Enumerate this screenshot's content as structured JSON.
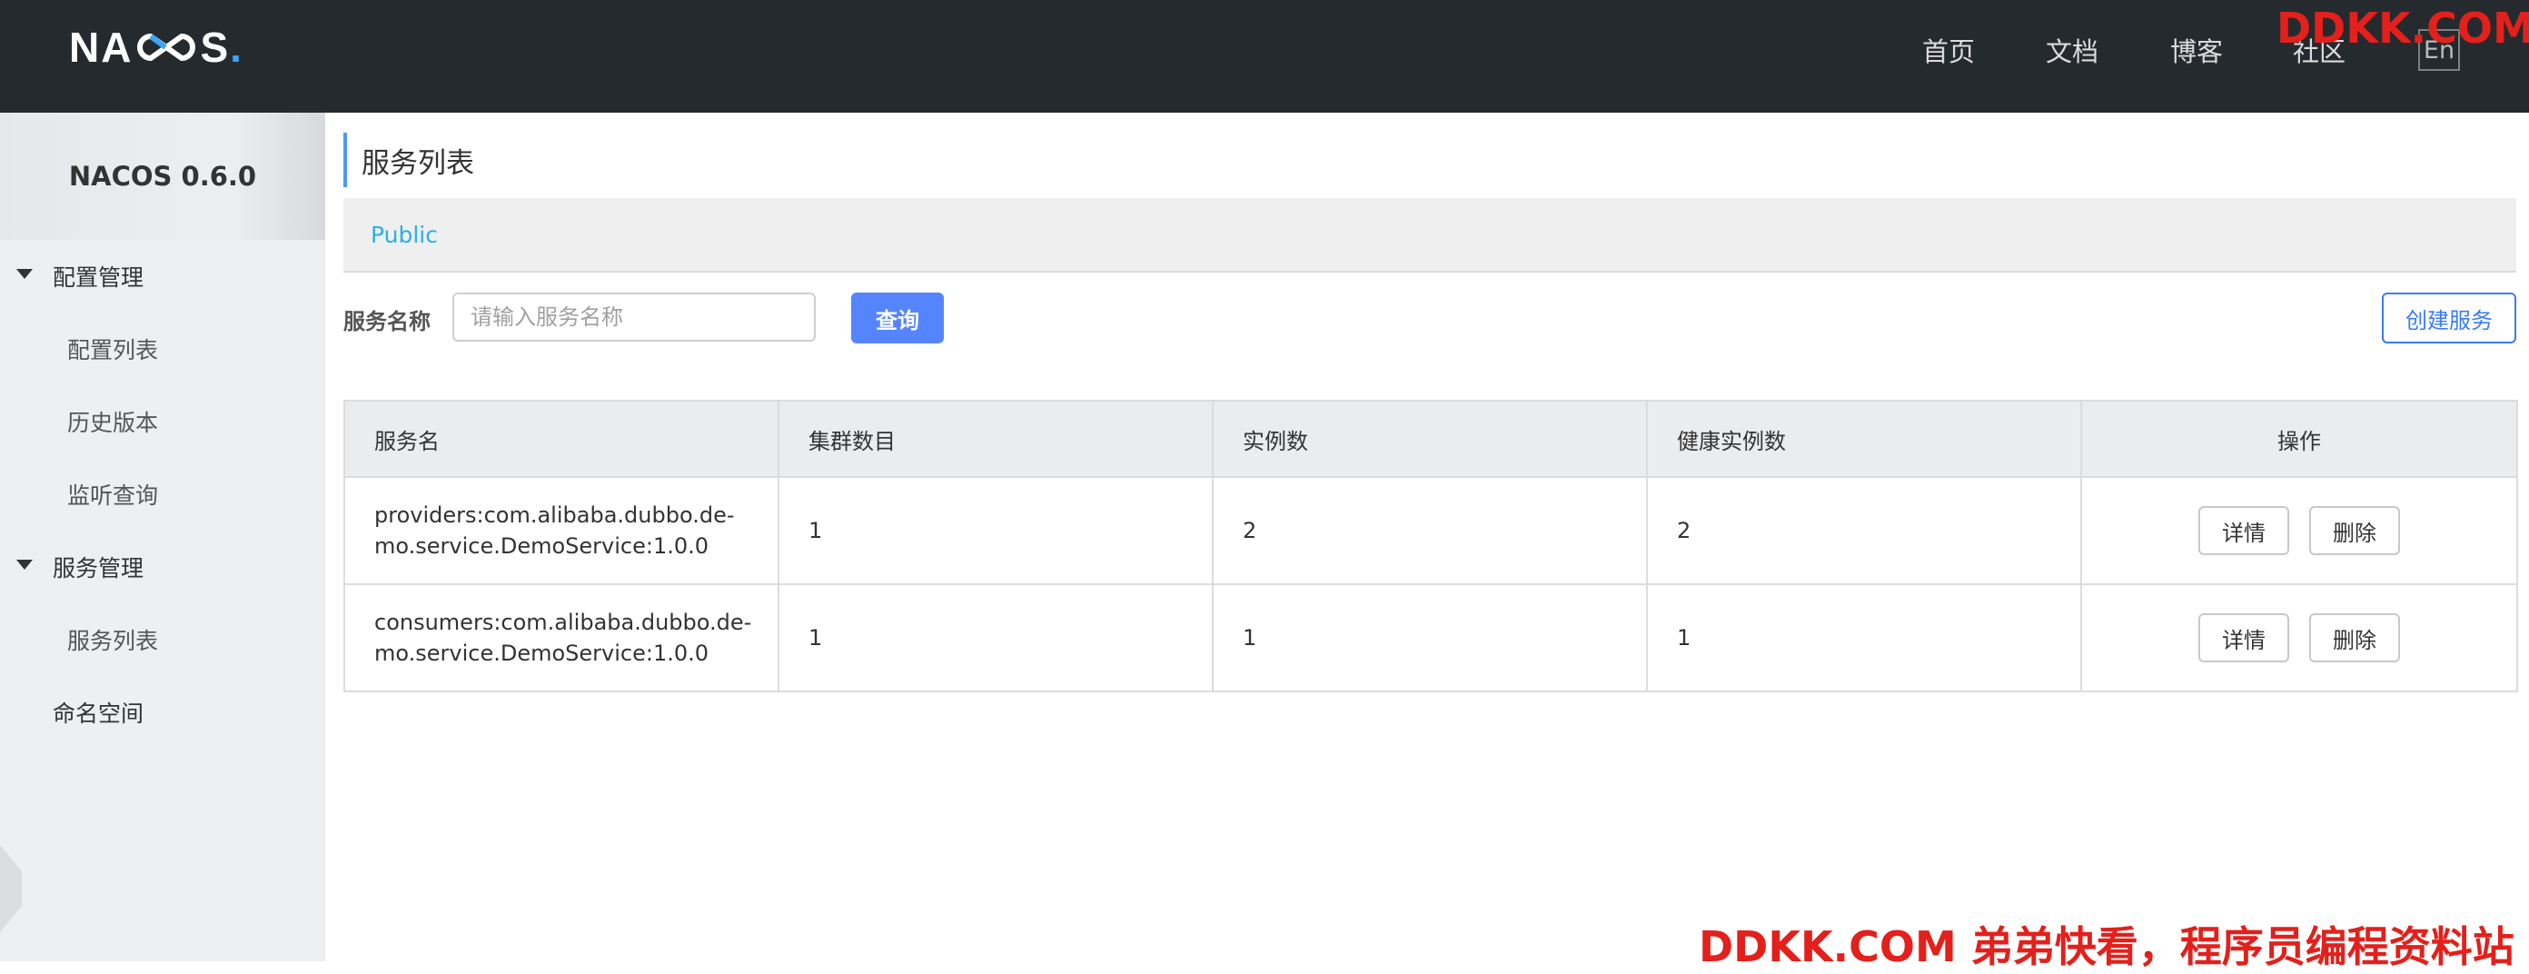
{
  "header": {
    "logo_text_left": "NA",
    "logo_text_mid": "CO",
    "logo_text_right": "S",
    "logo_dot": ".",
    "nav": [
      "首页",
      "文档",
      "博客",
      "社区"
    ],
    "lang_button": "En"
  },
  "sidebar": {
    "title": "NACOS 0.6.0",
    "groups": [
      {
        "label": "配置管理",
        "items": [
          "配置列表",
          "历史版本",
          "监听查询"
        ]
      },
      {
        "label": "服务管理",
        "items": [
          "服务列表"
        ]
      }
    ],
    "namespace_item": "命名空间"
  },
  "main": {
    "title": "服务列表",
    "namespace_tab": "Public",
    "search": {
      "label": "服务名称",
      "placeholder": "请输入服务名称",
      "value": "",
      "query_button": "查询"
    },
    "create_button": "创建服务",
    "table": {
      "headers": [
        "服务名",
        "集群数目",
        "实例数",
        "健康实例数",
        "操作"
      ],
      "rows": [
        {
          "service_line1": "providers:com.alibaba.dubbo.de-",
          "service_line2": "mo.service.DemoService:1.0.0",
          "clusters": "1",
          "instances": "2",
          "healthy": "2",
          "detail": "详情",
          "delete": "删除"
        },
        {
          "service_line1": "consumers:com.alibaba.dubbo.de-",
          "service_line2": "mo.service.DemoService:1.0.0",
          "clusters": "1",
          "instances": "1",
          "healthy": "1",
          "detail": "详情",
          "delete": "删除"
        }
      ]
    }
  },
  "watermark": {
    "top": "DDKK.COM",
    "bottom": "DDKK.COM 弟弟快看，程序员编程资料站"
  },
  "colors": {
    "topbar": "#252a2f",
    "primary": "#5584ff",
    "link": "#2ab0e5",
    "watermark": "#e3201b"
  }
}
